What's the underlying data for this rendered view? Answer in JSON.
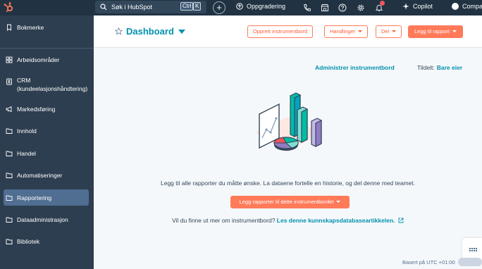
{
  "topbar": {
    "search_placeholder": "Søk i HubSpot",
    "kbd_ctrl": "Ctrl",
    "kbd_k": "K",
    "plus": "+",
    "upgrade_label": "Oppgradering",
    "copilot_label": "Copilot",
    "company_label": "Compa"
  },
  "sidebar": {
    "items": [
      {
        "label": "Bokmerke",
        "icon": "bookmark-icon"
      },
      {
        "label": "Arbeidsområder",
        "icon": "grid-icon"
      },
      {
        "label": "CRM (kundeelasjonshåndtering)",
        "icon": "contact-icon"
      },
      {
        "label": "Markedsføring",
        "icon": "megaphone-icon"
      },
      {
        "label": "Innhold",
        "icon": "folder-icon"
      },
      {
        "label": "Handel",
        "icon": "folder-icon"
      },
      {
        "label": "Automatiseringer",
        "icon": "folder-icon"
      },
      {
        "label": "Rapportering",
        "icon": "folder-icon"
      },
      {
        "label": "Dataadministrasjon",
        "icon": "folder-icon"
      },
      {
        "label": "Bibliotek",
        "icon": "folder-icon"
      }
    ]
  },
  "header": {
    "title": "Dashboard",
    "create_dashboard": "Opprett instrumentbord",
    "actions": "Handlinger",
    "share": "Del",
    "add_report": "Legg til rapport"
  },
  "main": {
    "manage_dashboards": "Administrer instrumentbord",
    "assigned_label": "Tildelt:",
    "assigned_value": "Bare eier",
    "empty_message": "Legg til alle rapporter du måtte ønske. La dataene fortelle en historie, og del denne med teamet.",
    "add_reports_button": "Legg rapporter til dette instrumentbordet",
    "learn_prefix": "Vil du finne ut mer om instrumentbord?",
    "learn_link": "Les denne kunnskapsdatabaseartikkelen.",
    "timezone": "Basert på UTC +01:00"
  },
  "colors": {
    "topbar": "#213343",
    "sidebar": "#2d3e50",
    "accent": "#ff7a59",
    "link": "#0091ae"
  }
}
